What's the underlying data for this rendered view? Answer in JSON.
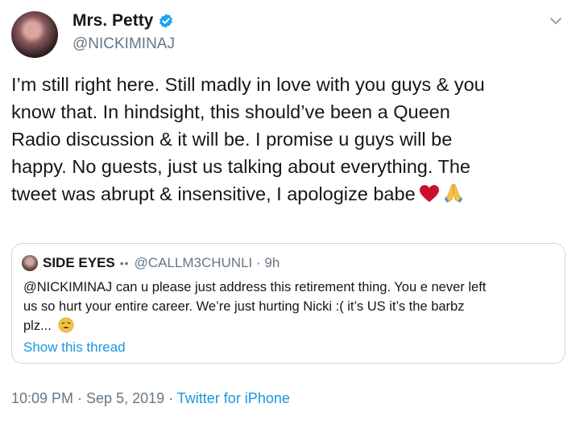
{
  "author": {
    "display_name": "Mrs. Petty",
    "handle": "@NICKIMINAJ",
    "verified": true
  },
  "tweet": {
    "lines": [
      "I’m still right here. Still madly in love with you guys & you",
      "know that. In hindsight, this should’ve been a Queen",
      "Radio discussion & it will be. I promise u guys will be",
      "happy. No guests, just us talking about everything. The",
      "tweet was abrupt & insensitive, I apologize babe"
    ],
    "emojis": [
      "red-heart",
      "folded-hands"
    ]
  },
  "quoted_tweet": {
    "display_name": "SIDE EYES",
    "name_emoji": "••",
    "handle_time": "@CALLM3CHUNLI · 9h",
    "lines": [
      "@NICKIMINAJ can u please just address this retirement thing. You e never left",
      "us so hurt your entire career. We’re just hurting Nicki :( it’s US it’s the barbz",
      "plz..."
    ],
    "show_thread": "Show this thread"
  },
  "meta": {
    "timestamp": "10:09 PM · Sep 5, 2019 · ",
    "source": "Twitter for iPhone"
  },
  "colors": {
    "text": "#14171a",
    "secondary": "#657786",
    "link": "#1b95e0",
    "border": "#ccd6dd"
  }
}
